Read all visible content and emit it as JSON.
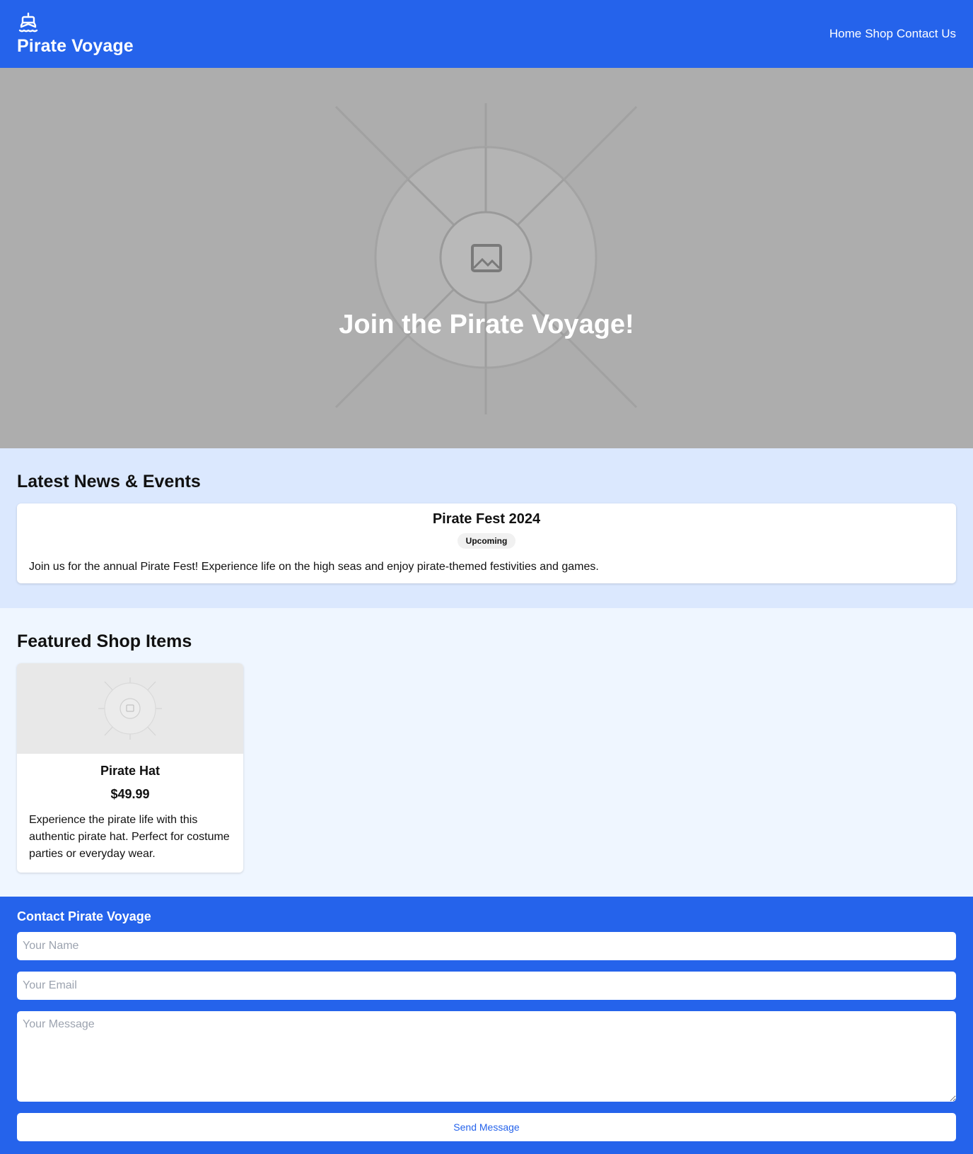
{
  "header": {
    "title": "Pirate Voyage",
    "logo_icon": "ship-icon",
    "nav": [
      "Home",
      "Shop",
      "Contact Us"
    ]
  },
  "hero": {
    "heading": "Join the Pirate Voyage!",
    "image_icon": "image-placeholder-icon"
  },
  "news": {
    "heading": "Latest News & Events",
    "items": [
      {
        "title": "Pirate Fest 2024",
        "status": "Upcoming",
        "description": "Join us for the annual Pirate Fest! Experience life on the high seas and enjoy pirate-themed festivities and games."
      }
    ]
  },
  "shop": {
    "heading": "Featured Shop Items",
    "items": [
      {
        "name": "Pirate Hat",
        "price": "$49.99",
        "description": "Experience the pirate life with this authentic pirate hat. Perfect for costume parties or everyday wear."
      }
    ]
  },
  "contact": {
    "heading": "Contact Pirate Voyage",
    "name_placeholder": "Your Name",
    "email_placeholder": "Your Email",
    "message_placeholder": "Your Message",
    "submit_label": "Send Message"
  },
  "colors": {
    "primary": "#2563eb",
    "news_bg": "#dbe8fe",
    "shop_bg": "#eff6ff",
    "hero_bg": "#adadad"
  }
}
